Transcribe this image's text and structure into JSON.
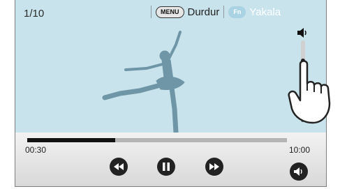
{
  "status": {
    "counter": "1/10"
  },
  "topbar": {
    "menu_key": "MENU",
    "menu_action": "Durdur",
    "fn_key": "Fn",
    "fn_action": "Yakala"
  },
  "volume": {
    "level": "6",
    "fraction": 0.75
  },
  "playback": {
    "elapsed": "00:30",
    "total": "10:00",
    "progress": 0.34
  },
  "icons": {
    "rewind": "rewind-icon",
    "pause": "pause-icon",
    "forward": "fast-forward-icon",
    "speaker": "speaker-icon",
    "volume_small": "volume-icon",
    "hand": "hand-touch-icon"
  },
  "colors": {
    "video_bg": "#c8e3ec",
    "dancer": "#6f96a7",
    "button": "#222222"
  }
}
